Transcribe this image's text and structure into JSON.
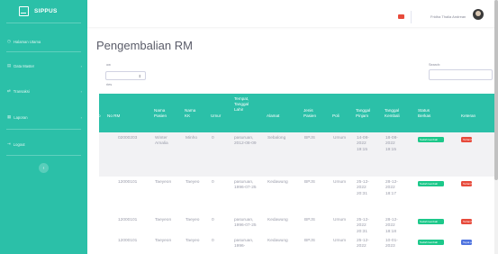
{
  "sidebar": {
    "brand": "SIPPUS",
    "items": [
      {
        "label": "Halaman Utama",
        "icon": "dashboard-icon",
        "has_caret": false
      },
      {
        "label": "Data Master",
        "icon": "database-icon",
        "has_caret": true
      },
      {
        "label": "Transaksi",
        "icon": "exchange-icon",
        "has_caret": true
      },
      {
        "label": "Laporan",
        "icon": "report-icon",
        "has_caret": true
      },
      {
        "label": "Logout",
        "icon": "logout-icon",
        "has_caret": false
      }
    ],
    "toggle_icon": "chevron-left-icon"
  },
  "topbar": {
    "user_name": "Fridha Thalia Andrean",
    "alert_icon": "bell-icon"
  },
  "page": {
    "title": "Pengembalian RM",
    "show_label": "ow",
    "entries_label": "ries",
    "search_label": "Search:",
    "length_value": ""
  },
  "table": {
    "headers": [
      "o",
      "No RM",
      "Nama Pasien",
      "Nama KK",
      "Umur",
      "Tempat, Tanggal Lahir",
      "Alamat",
      "Jenis Pasien",
      "Poli",
      "Tanggal Pinjam",
      "Tanggal Kembali",
      "Status Berkas",
      "Keteran"
    ],
    "rows": [
      {
        "no_rm": "02000203",
        "nama": "Winter Amalia",
        "kk": "Minho",
        "umur": "0",
        "ttl": "pasuruan, 2012-08-09",
        "alamat": "Sebalong",
        "jenis": "BPJS",
        "poli": "Umum",
        "pinjam": "14-08-2022 19:15",
        "kembali": "18-08-2022 19:15",
        "status": "Sudah kembali",
        "ket": "Terlambat",
        "ket_color": "red"
      },
      {
        "no_rm": "12000101",
        "nama": "Taeyeon",
        "kk": "Taeyeo",
        "umur": "0",
        "ttl": "pasuruan, 1996-07-25",
        "alamat": "Kedawung",
        "jenis": "BPJS",
        "poli": "Umum",
        "pinjam": "25-12-2022 20:31",
        "kembali": "28-12-2022 18:17",
        "status": "Sudah kembali",
        "ket": "Terlambat",
        "ket_color": "red"
      },
      {
        "no_rm": "12000101",
        "nama": "Taeyeon",
        "kk": "Taeyeo",
        "umur": "0",
        "ttl": "pasuruan, 1996-07-25",
        "alamat": "Kedawung",
        "jenis": "BPJS",
        "poli": "Umum",
        "pinjam": "25-12-2022 20:31",
        "kembali": "28-12-2022 18:18",
        "status": "Sudah kembali",
        "ket": "Terlambat",
        "ket_color": "red"
      },
      {
        "no_rm": "12000101",
        "nama": "Taeyeon",
        "kk": "Taeyeo",
        "umur": "0",
        "ttl": "pasuruan, 1996-",
        "alamat": "Kedawung",
        "jenis": "BPJS",
        "poli": "Umum",
        "pinjam": "25-12-2022",
        "kembali": "10-01-2023",
        "status": "Sudah kembali",
        "ket": "Tepat waktu",
        "ket_color": "blue"
      }
    ]
  },
  "colors": {
    "primary": "#2bc0a8",
    "success": "#1cc88a",
    "danger": "#e74a3b",
    "info": "#4e73df"
  }
}
